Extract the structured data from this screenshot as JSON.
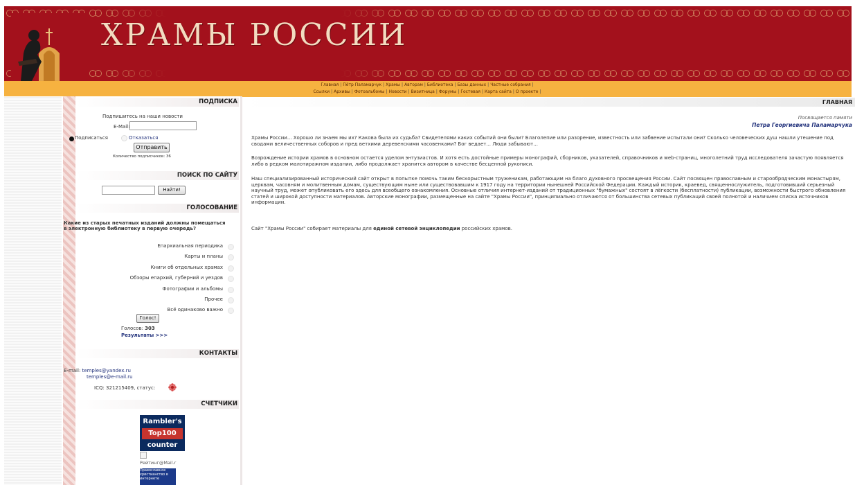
{
  "header": {
    "title": "ХРАМЫ РОССИИ"
  },
  "nav": {
    "row1": [
      "Главная",
      "Пётр Паламарчук",
      "Храмы",
      "Авторам",
      "Библиотека",
      "Базы данных",
      "Частные собрания"
    ],
    "row2": [
      "Ссылки",
      "Архивы",
      "Фотоальбомы",
      "Новости",
      "Визитница",
      "Форумы",
      "Гостевая",
      "Карта сайта",
      "О проекте"
    ]
  },
  "subscribe": {
    "heading": "ПОДПИСКА",
    "invite": "Подпишитесь на наши новости",
    "email_label": "E-Mail:",
    "email_value": "",
    "subscribe_option": "Подписаться",
    "unsubscribe_option": "Отказаться",
    "send_button": "Отправить",
    "count_text": "Количество подписчиков: 36"
  },
  "search": {
    "heading": "ПОИСК ПО САЙТУ",
    "query": "",
    "button": "Найти!"
  },
  "poll": {
    "heading": "ГОЛОСОВАНИЕ",
    "question": "Какие из старых печатных изданий должны помещаться в электронную библиотеку в первую очередь?",
    "options": [
      "Епархиальная периодика",
      "Карты и планы",
      "Книги об отдельных храмах",
      "Обзоры епархий, губерний и уездов",
      "Фотографии и альбомы",
      "Прочее",
      "Всё одинаково важно"
    ],
    "vote_button": "Голос!",
    "votes_label": "Голосов:",
    "votes_count": "303",
    "results_link": "Результаты >>>"
  },
  "contacts": {
    "heading": "КОНТАКТЫ",
    "email_label": "E-mail:",
    "email1": "temples@yandex.ru",
    "email2": "temples@e-mail.ru",
    "icq": "ICQ: 321215409, статус:"
  },
  "counters": {
    "heading": "СЧЕТЧИКИ",
    "rambler_line1": "Rambler's",
    "rambler_line2": "Top100",
    "rambler_line3": "counter",
    "mailru": "Рейтинг@Mail.r",
    "pravo": "Православное христианство в интернете"
  },
  "main": {
    "heading": "ГЛАВНАЯ",
    "dedication_line1": "Посвящается памяти",
    "dedication_line2": "Петра Георгиевича Паламарчука",
    "para1": "Храмы России... Хорошо ли знаем мы их? Какова была их судьба? Свидетелями каких событий они были? Благолепие или разорение, известность или забвение испытали они? Сколько человеческих душ нашли утешение под сводами величественных соборов и пред ветхими деревенскими часовенками? Бог ведает... Люди забывают...",
    "para2": "Возрождение истории храмов в основном остается уделом энтузиастов. И хотя есть достойные примеры монографий, сборников, указателей, справочников и web-страниц, многолетний труд исследователя зачастую появляется либо в редком малотиражном издании, либо продолжает хранится автором в качестве бесценной рукописи.",
    "para3": "Наш специализированный исторический сайт открыт в попытке помочь таким бескорыстным труженикам, работающим на благо духовного просвещения России. Сайт посвящен православным и старообрядческим монастырям, церквам, часовням и молитвенным домам, существующим ныне или существовавшим к 1917 году на территории нынешней Российской Федерации. Каждый историк, краевед, священнослужитель, подготовивший серьезный научный труд, может опубликовать его здесь для всеобщего ознакомления. Основные отличия интернет-изданий от традиционных \"бумажных\" состоят в лёгкости (бесплатности) публикации, возможности быстрого обновления статей и широкой доступности материалов. Авторские монографии, размещенные на сайте \"Храмы России\", принципиально отличаются от большинства сетевых публикаций своей полнотой и наличием списка источников информации.",
    "para4_pre": "Сайт \"Храмы России\" собирает материалы для ",
    "para4_bold": "единой сетевой энциклопедии",
    "para4_post": " российских храмов."
  },
  "colors": {
    "header_red": "#a3111c",
    "nav_orange": "#f6b240",
    "link_blue": "#1f2f7a"
  }
}
